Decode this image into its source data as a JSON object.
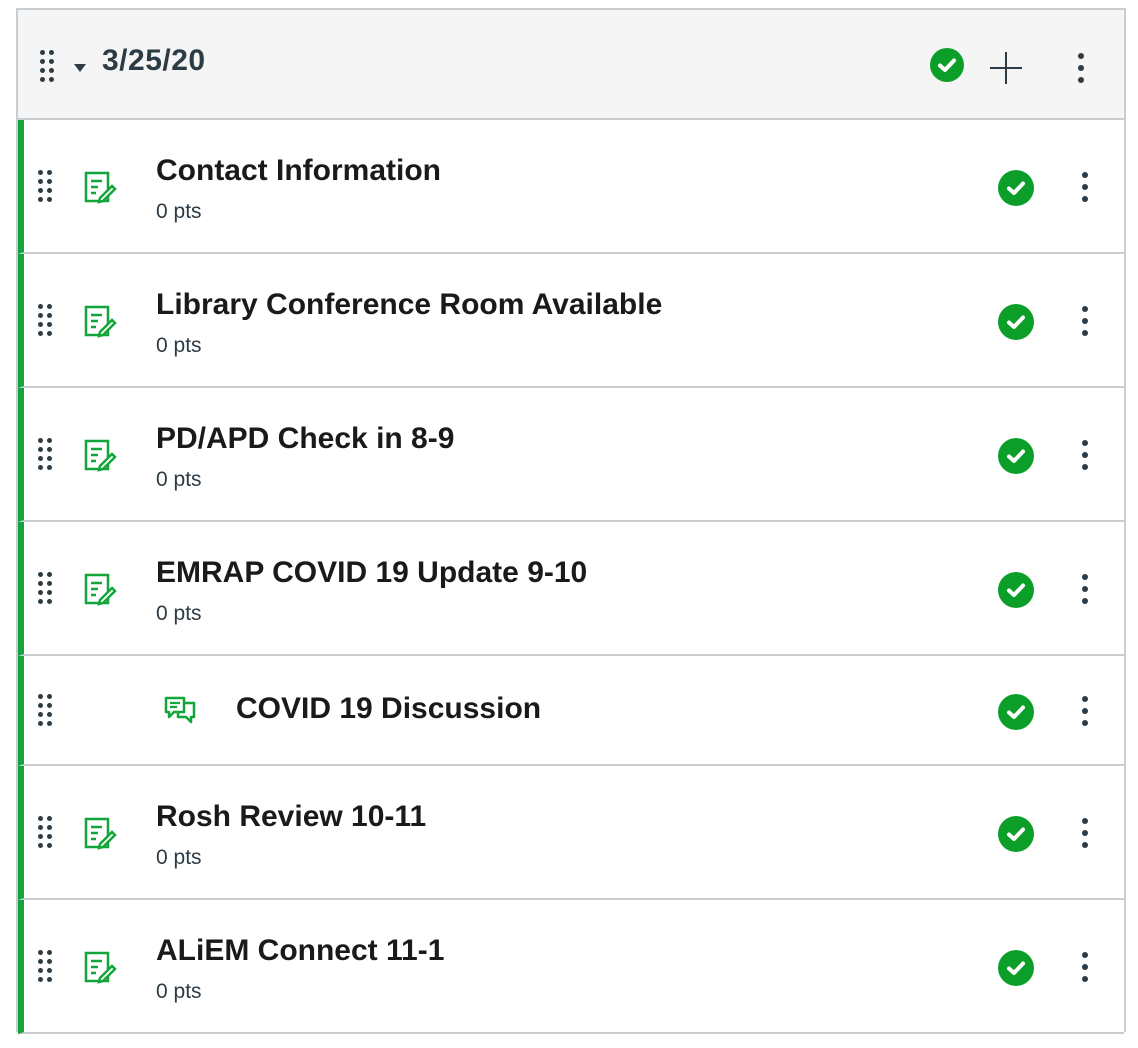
{
  "module": {
    "title": "3/25/20",
    "published": true
  },
  "items": [
    {
      "title": "Contact Information",
      "points": "0 pts",
      "icon": "assignment-icon",
      "published": true
    },
    {
      "title": "Library Conference Room Available",
      "points": "0 pts",
      "icon": "assignment-icon",
      "published": true
    },
    {
      "title": "PD/APD Check in 8-9",
      "points": "0 pts",
      "icon": "assignment-icon",
      "published": true
    },
    {
      "title": "EMRAP COVID 19 Update 9-10",
      "points": "0 pts",
      "icon": "assignment-icon",
      "published": true
    },
    {
      "title": "COVID 19 Discussion",
      "points": "",
      "icon": "discussion-icon",
      "published": true
    },
    {
      "title": "Rosh Review 10-11",
      "points": "0 pts",
      "icon": "assignment-icon",
      "published": true
    },
    {
      "title": "ALiEM Connect 11-1",
      "points": "0 pts",
      "icon": "assignment-icon",
      "published": true
    }
  ],
  "colors": {
    "accent": "#0b9f2a",
    "border": "#c7cdd1",
    "text": "#2d3b45"
  }
}
